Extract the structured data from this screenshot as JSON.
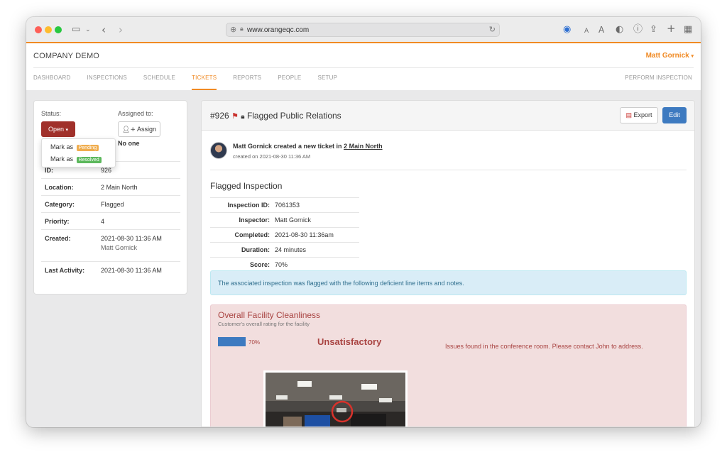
{
  "browser": {
    "url": "www.orangeqc.com"
  },
  "header": {
    "company": "COMPANY DEMO",
    "user": "Matt Gornick",
    "nav": [
      "DASHBOARD",
      "INSPECTIONS",
      "SCHEDULE",
      "TICKETS",
      "REPORTS",
      "PEOPLE",
      "SETUP"
    ],
    "active_tab": "TICKETS",
    "perform": "PERFORM INSPECTION"
  },
  "ticket_panel": {
    "status_label": "Status:",
    "status_value": "Open",
    "assigned_label": "Assigned to:",
    "assign_button": "Assign",
    "assigned_value": "No one",
    "dropdown": {
      "mark_as": "Mark as",
      "pending": "Pending",
      "resolved": "Resolved"
    },
    "rows": [
      {
        "label": "ID:",
        "value": "926"
      },
      {
        "label": "Location:",
        "value": "2 Main North"
      },
      {
        "label": "Category:",
        "value": "Flagged"
      },
      {
        "label": "Priority:",
        "value": "4"
      },
      {
        "label": "Created:",
        "value": "2021-08-30 11:36 AM",
        "sub": "Matt Gornick"
      },
      {
        "label": "Last Activity:",
        "value": "2021-08-30 11:36 AM"
      }
    ]
  },
  "ticket": {
    "number": "#926",
    "title": "Flagged Public Relations",
    "export": "Export",
    "edit": "Edit",
    "activity_text": "Matt Gornick created a new ticket in",
    "activity_link": "2 Main North",
    "created_on": "created on 2021-08-30 11:36 AM",
    "section": "Flagged Inspection",
    "inspection": [
      {
        "label": "Inspection ID:",
        "value": "7061353"
      },
      {
        "label": "Inspector:",
        "value": "Matt Gornick"
      },
      {
        "label": "Completed:",
        "value": "2021-08-30 11:36am"
      },
      {
        "label": "Duration:",
        "value": "24 minutes"
      },
      {
        "label": "Score:",
        "value": "70%"
      }
    ],
    "alert": "The associated inspection was flagged with the following deficient line items and notes.",
    "item": {
      "title": "Overall Facility Cleanliness",
      "subtitle": "Customer's overall rating for the facility",
      "score": "70%",
      "score_fraction": 0.7,
      "rating": "Unsatisfactory",
      "note": "Issues found in the conference room. Please contact John to address."
    }
  },
  "colors": {
    "accent": "#f08a24",
    "danger": "#a0302a",
    "primary": "#3d7ac0",
    "pending": "#f0ad4e",
    "resolved": "#5cb85c"
  }
}
